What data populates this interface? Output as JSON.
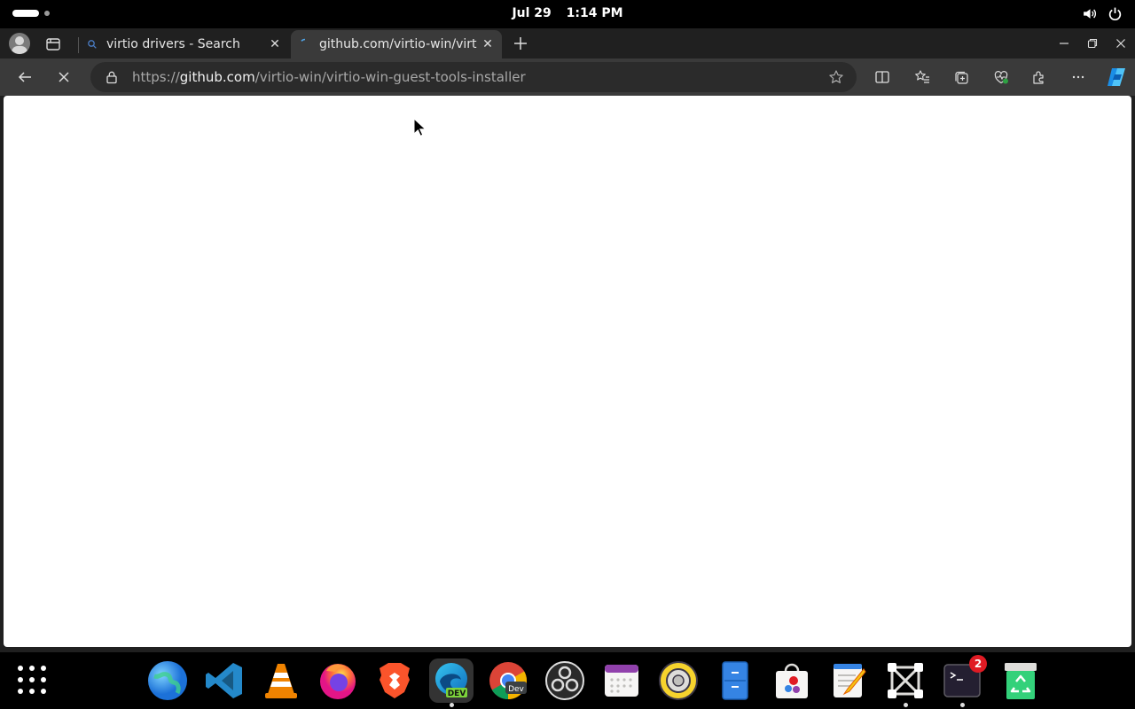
{
  "topbar": {
    "date": "Jul 29",
    "time": "1:14 PM",
    "icons": [
      "volume-icon",
      "power-icon"
    ]
  },
  "browser": {
    "tabs": [
      {
        "title": "virtio drivers - Search",
        "favicon": "search-icon",
        "active": false
      },
      {
        "title": "github.com/virtio-win/virtio-win-guest-tools-installer",
        "favicon": "loading-icon",
        "active": true
      }
    ],
    "address": {
      "scheme": "https://",
      "host": "github.com",
      "path": "/virtio-win/virtio-win-guest-tools-installer"
    },
    "toolbar_icons": [
      "back-icon",
      "stop-icon",
      "split-screen-icon",
      "favorites-icon",
      "collections-icon",
      "browser-essentials-icon",
      "extensions-icon",
      "more-icon",
      "copilot-icon"
    ]
  },
  "dock": {
    "apps": [
      {
        "name": "Web Browser"
      },
      {
        "name": "Visual Studio Code"
      },
      {
        "name": "VLC"
      },
      {
        "name": "Firefox"
      },
      {
        "name": "Brave"
      },
      {
        "name": "Microsoft Edge Dev",
        "label": "DEV",
        "running": true
      },
      {
        "name": "Chrome Dev",
        "label": "Dev"
      },
      {
        "name": "OBS Studio"
      },
      {
        "name": "Calendar"
      },
      {
        "name": "Rhythmbox"
      },
      {
        "name": "Files"
      },
      {
        "name": "Software"
      },
      {
        "name": "Text Editor"
      },
      {
        "name": "Boxes",
        "running": true
      },
      {
        "name": "Terminal",
        "badge": "2",
        "running": true
      },
      {
        "name": "Trash"
      }
    ]
  },
  "colors": {
    "edge_blue": "#0f6cbd",
    "badge_red": "#e01b24"
  }
}
